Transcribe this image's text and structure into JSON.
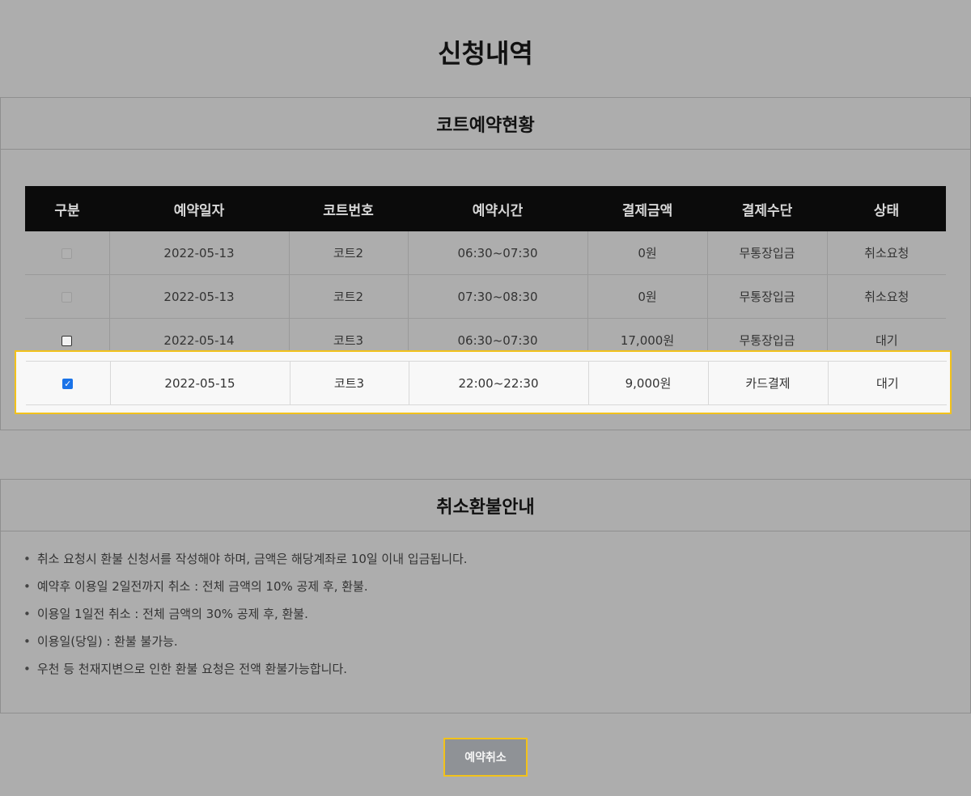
{
  "page_title": "신청내역",
  "reservations": {
    "title": "코트예약현황",
    "columns": [
      "구분",
      "예약일자",
      "코트번호",
      "예약시간",
      "결제금액",
      "결제수단",
      "상태"
    ],
    "rows": [
      {
        "checkbox": "disabled",
        "date": "2022-05-13",
        "court": "코트2",
        "time": "06:30~07:30",
        "amount": "0원",
        "method": "무통장입금",
        "status": "취소요청"
      },
      {
        "checkbox": "disabled",
        "date": "2022-05-13",
        "court": "코트2",
        "time": "07:30~08:30",
        "amount": "0원",
        "method": "무통장입금",
        "status": "취소요청"
      },
      {
        "checkbox": "unchecked",
        "date": "2022-05-14",
        "court": "코트3",
        "time": "06:30~07:30",
        "amount": "17,000원",
        "method": "무통장입금",
        "status": "대기"
      },
      {
        "checkbox": "checked",
        "date": "2022-05-15",
        "court": "코트3",
        "time": "22:00~22:30",
        "amount": "9,000원",
        "method": "카드결제",
        "status": "대기"
      }
    ]
  },
  "refund": {
    "title": "취소환불안내",
    "items": [
      "취소 요청시 환불 신청서를 작성해야 하며, 금액은 해당계좌로 10일 이내 입금됩니다.",
      "예약후 이용일 2일전까지 취소 : 전체 금액의 10% 공제 후, 환불.",
      "이용일 1일전 취소 : 전체 금액의 30% 공제 후, 환불.",
      "이용일(당일) : 환불 불가능.",
      "우천 등 천재지변으로 인한 환불 요청은 전액 환불가능합니다."
    ]
  },
  "cancel_button_label": "예약취소",
  "colors": {
    "background": "#adadad",
    "header_bg": "#0b0b0b",
    "highlight_border": "#f2c21b",
    "button_bg": "#8f9296",
    "checkbox_checked": "#1a73e8"
  }
}
